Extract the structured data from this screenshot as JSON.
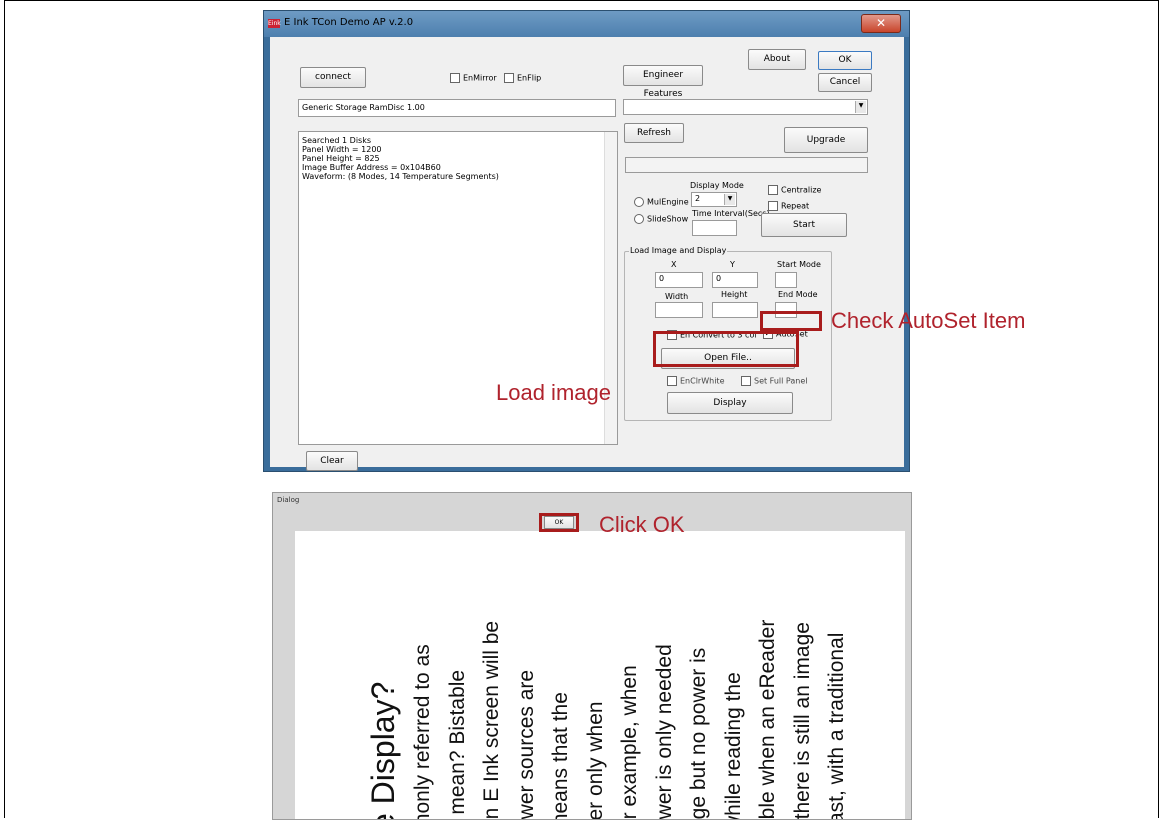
{
  "window": {
    "title": "E Ink TCon Demo AP v.2.0",
    "icon_label": "Eink",
    "close_glyph": "✕"
  },
  "top": {
    "connect_label": "connect",
    "enmirror_label": "EnMirror",
    "enflip_label": "EnFlip",
    "engineer_label": "Engineer Features",
    "about_label": "About",
    "ok_label": "OK",
    "cancel_label": "Cancel"
  },
  "device": {
    "storage_value": "Generic Storage RamDisc 1.00",
    "combo_value": ""
  },
  "log": {
    "lines": [
      "Searched 1 Disks",
      "Panel Width = 1200",
      "Panel Height = 825",
      "Image Buffer Address = 0x104B60",
      "Waveform: (8 Modes, 14 Temperature Segments)"
    ],
    "clear_label": "Clear"
  },
  "controls": {
    "refresh_label": "Refresh",
    "upgrade_label": "Upgrade",
    "display_mode_label": "Display Mode",
    "display_mode_value": "2",
    "mulengine_label": "MulEngine",
    "slideshow_label": "SlideShow",
    "time_interval_label": "Time Interval(Secs)",
    "centralize_label": "Centralize",
    "repeat_label": "Repeat",
    "start_label": "Start"
  },
  "load_group": {
    "legend": "Load Image and Display",
    "x_label": "X",
    "y_label": "Y",
    "x_value": "0",
    "y_value": "0",
    "start_mode_label": "Start Mode",
    "end_mode_label": "End Mode",
    "width_label": "Width",
    "height_label": "Height",
    "convert_label": "En Convert to 3 col",
    "autoset_label": "AutoSet",
    "autoset_check": "✓",
    "open_file_label": "Open File..",
    "enclrwhite_label": "EnClrWhite",
    "setfull_label": "Set Full Panel",
    "display_label": "Display"
  },
  "annotations": {
    "check_autoset": "Check AutoSet Item",
    "load_image": "Load image",
    "click_ok": "Click OK"
  },
  "dialog": {
    "title": "Dialog",
    "ok_label": "OK",
    "heading": "e Display?",
    "columns": [
      "monly referred to as",
      "s mean? Bistable",
      "an E Ink screen will be",
      "ower sources are",
      "means that the",
      "ver only when",
      "or example, when",
      "ower is only needed",
      "age but no power is",
      " while reading the",
      "able when an eReader",
      "; there is still an image",
      "rast, with a traditional"
    ]
  },
  "colors": {
    "highlight": "#a81c1c",
    "annotation_text": "#b0232d",
    "titlebar": "#5a8cb9"
  }
}
